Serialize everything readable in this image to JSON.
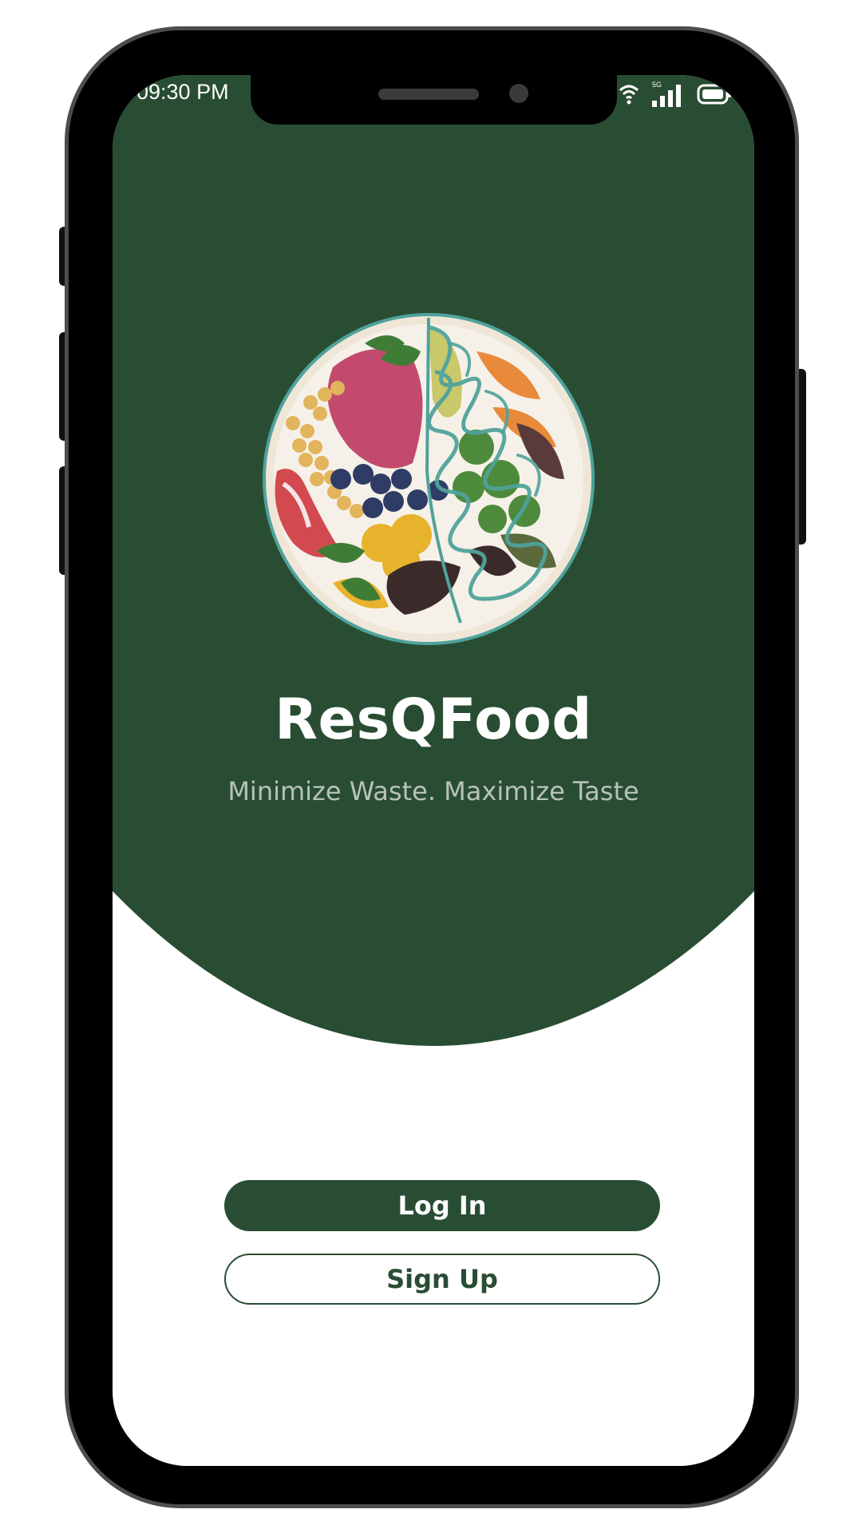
{
  "status_bar": {
    "time": "09:30 PM",
    "network": "5G",
    "icons": [
      "wifi-icon",
      "signal-icon",
      "battery-icon"
    ]
  },
  "app": {
    "name": "ResQFood",
    "tagline": "Minimize Waste. Maximize Taste"
  },
  "actions": {
    "login_label": "Log In",
    "signup_label": "Sign Up"
  },
  "colors": {
    "brand_green": "#294d33",
    "accent_teal": "#4fa29c",
    "tagline_gray": "#b7c2b9",
    "background": "#ffffff"
  }
}
